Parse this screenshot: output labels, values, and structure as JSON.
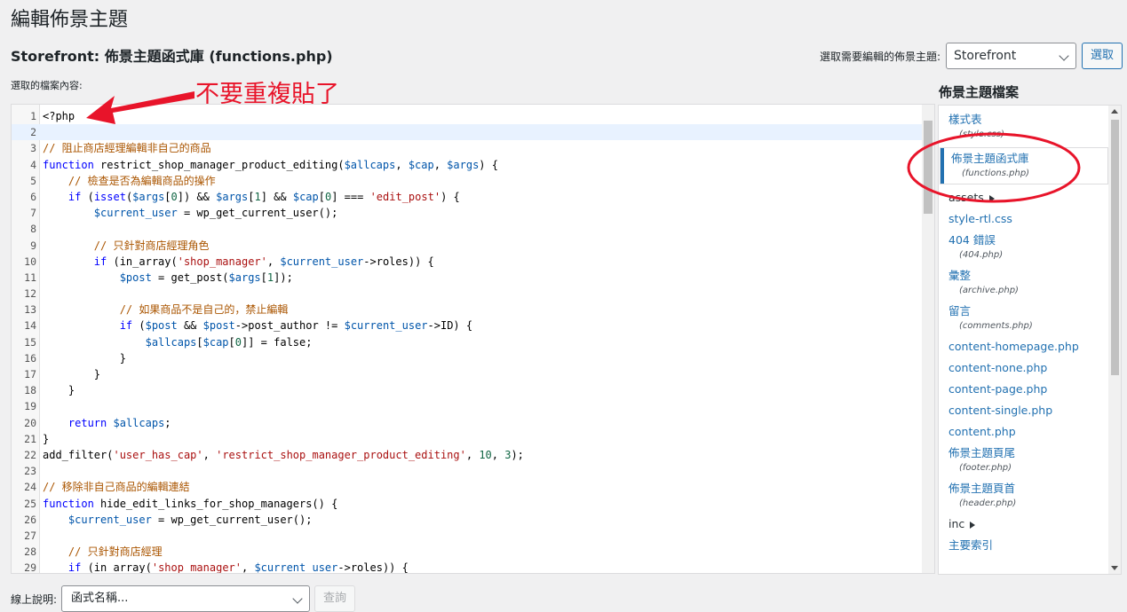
{
  "page_title": "編輯佈景主題",
  "file_title": "Storefront: 佈景主題函式庫 (functions.php)",
  "theme_picker": {
    "label": "選取需要編輯的佈景主題:",
    "selected": "Storefront",
    "button": "選取"
  },
  "selected_file_label": "選取的檔案內容:",
  "annotation": "不要重複貼了",
  "code_lines": [
    "<?php",
    "",
    "// 阻止商店經理編輯非自己的商品",
    "function restrict_shop_manager_product_editing($allcaps, $cap, $args) {",
    "    // 檢查是否為編輯商品的操作",
    "    if (isset($args[0]) && $args[1] && $cap[0] === 'edit_post') {",
    "        $current_user = wp_get_current_user();",
    "",
    "        // 只針對商店經理角色",
    "        if (in_array('shop_manager', $current_user->roles)) {",
    "            $post = get_post($args[1]);",
    "",
    "            // 如果商品不是自己的，禁止編輯",
    "            if ($post && $post->post_author != $current_user->ID) {",
    "                $allcaps[$cap[0]] = false;",
    "            }",
    "        }",
    "    }",
    "",
    "    return $allcaps;",
    "}",
    "add_filter('user_has_cap', 'restrict_shop_manager_product_editing', 10, 3);",
    "",
    "// 移除非自己商品的編輯連結",
    "function hide_edit_links_for_shop_managers() {",
    "    $current_user = wp_get_current_user();",
    "",
    "    // 只針對商店經理",
    "    if (in_array('shop_manager', $current_user->roles)) {"
  ],
  "sidebar": {
    "title": "佈景主題檔案",
    "files": [
      {
        "name": "樣式表",
        "sub": "(style.css)"
      },
      {
        "name": "佈景主題函式庫",
        "sub": "(functions.php)",
        "current": true
      },
      {
        "name": "assets",
        "folder": true
      },
      {
        "name": "style-rtl.css"
      },
      {
        "name": "404 錯誤",
        "sub": "(404.php)"
      },
      {
        "name": "彙整",
        "sub": "(archive.php)"
      },
      {
        "name": "留言",
        "sub": "(comments.php)"
      },
      {
        "name": "content-homepage.php"
      },
      {
        "name": "content-none.php"
      },
      {
        "name": "content-page.php"
      },
      {
        "name": "content-single.php"
      },
      {
        "name": "content.php"
      },
      {
        "name": "佈景主題頁尾",
        "sub": "(footer.php)"
      },
      {
        "name": "佈景主題頁首",
        "sub": "(header.php)"
      },
      {
        "name": "inc",
        "folder": true
      },
      {
        "name": "主要索引"
      }
    ]
  },
  "docs": {
    "label": "線上說明:",
    "placeholder": "函式名稱...",
    "button": "查詢"
  },
  "colors": {
    "accent": "#2271b1",
    "annotation": "#e8142a"
  }
}
